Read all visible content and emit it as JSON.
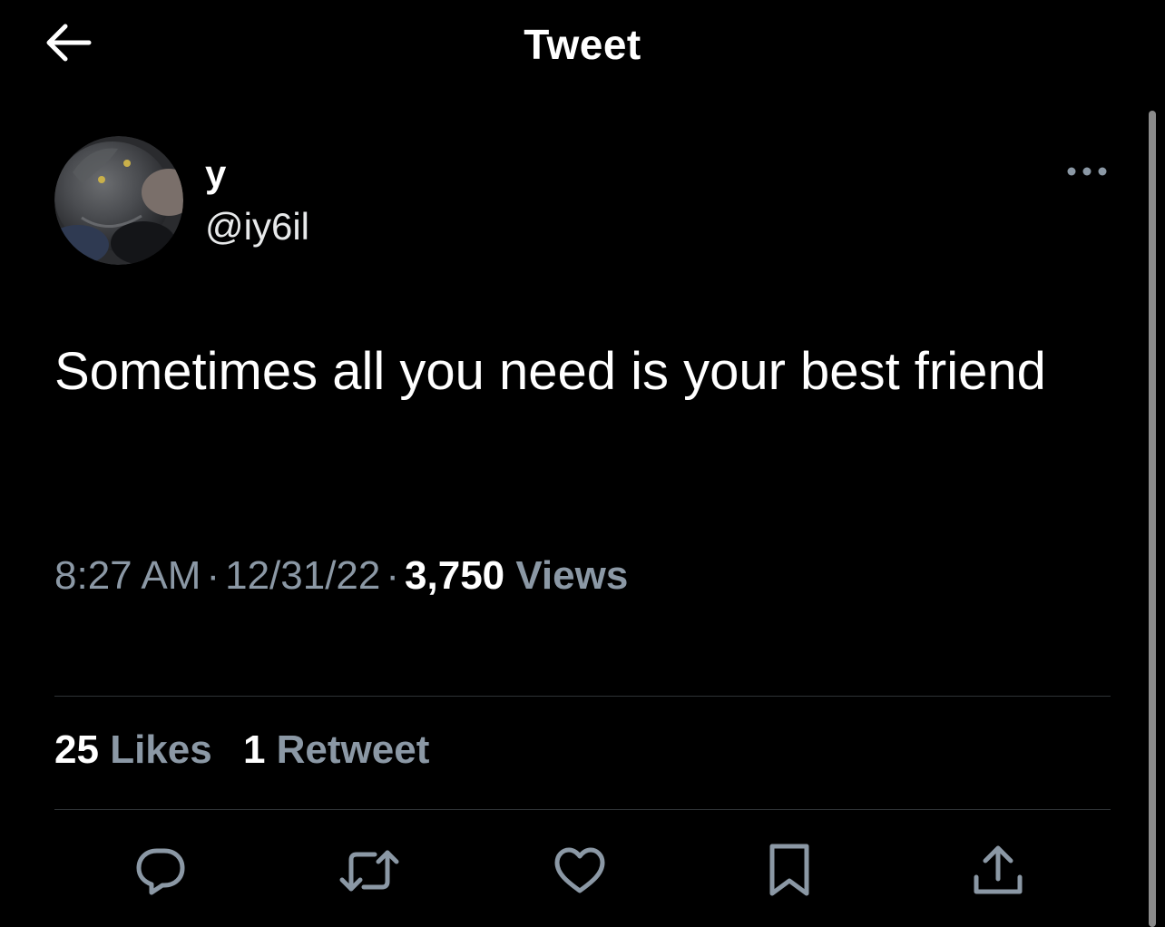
{
  "header": {
    "title": "Tweet",
    "back_icon": "arrow-left-icon"
  },
  "author": {
    "display_name": "y",
    "handle": "@iy6il",
    "avatar": "avatar-photo"
  },
  "tweet": {
    "text": "Sometimes all you need is your best friend",
    "time": "8:27 AM",
    "date": "12/31/22",
    "views_count": "3,750",
    "views_label": "Views",
    "separator": "·"
  },
  "stats": {
    "likes_count": "25",
    "likes_label": "Likes",
    "retweets_count": "1",
    "retweets_label": "Retweet"
  },
  "actions": [
    {
      "icon": "reply-icon"
    },
    {
      "icon": "retweet-icon"
    },
    {
      "icon": "like-icon"
    },
    {
      "icon": "bookmark-icon"
    },
    {
      "icon": "share-icon"
    }
  ],
  "colors": {
    "background": "#000000",
    "primary_text": "#ffffff",
    "secondary_text": "#8b98a5",
    "divider": "#2f3336"
  }
}
